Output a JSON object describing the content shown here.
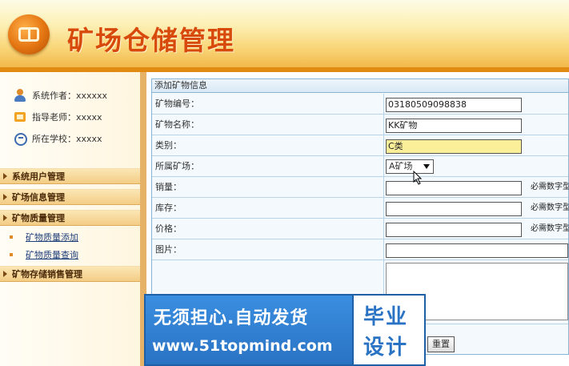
{
  "header": {
    "app_title": "矿场仓储管理"
  },
  "sidebar": {
    "info": [
      {
        "label": "系统作者：xxxxxx",
        "icon": "user-icon"
      },
      {
        "label": "指导老师：xxxxx",
        "icon": "teacher-icon"
      },
      {
        "label": "所在学校：xxxxx",
        "icon": "school-icon"
      }
    ],
    "menus": [
      {
        "label": "系统用户管理"
      },
      {
        "label": "矿场信息管理"
      },
      {
        "label": "矿物质量管理",
        "children": [
          "矿物质量添加",
          "矿物质量查询"
        ]
      },
      {
        "label": "矿物存储销售管理"
      }
    ]
  },
  "form": {
    "title": "添加矿物信息",
    "fields": [
      {
        "label": "矿物编号：",
        "value": "03180509098838"
      },
      {
        "label": "矿物名称：",
        "value": "KK矿物"
      },
      {
        "label": "类别：",
        "value": "C类"
      },
      {
        "label": "所属矿场：",
        "value": "A矿场"
      },
      {
        "label": "销量：",
        "value": "",
        "hint": "必需数字型"
      },
      {
        "label": "库存：",
        "value": "",
        "hint": "必需数字型"
      },
      {
        "label": "价格：",
        "value": "",
        "hint": "必需数字型"
      },
      {
        "label": "图片：",
        "value": ""
      }
    ],
    "reset_label": "重置"
  },
  "watermark": {
    "line1": "无须担心.自动发货",
    "url": "www.51topmind.com",
    "right1": "毕业",
    "right2": "设计"
  },
  "colors": {
    "accent": "#e08a12",
    "title": "#d84a0c",
    "watermark": "#2a73c4"
  }
}
